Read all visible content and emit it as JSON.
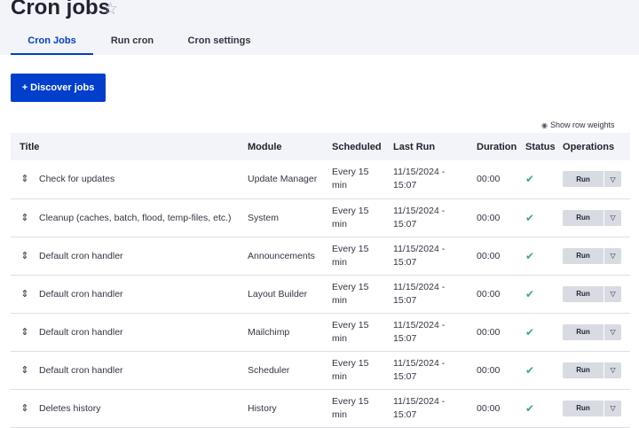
{
  "page": {
    "title": "Cron jobs",
    "star_icon": "star-outline-icon"
  },
  "tabs": [
    {
      "label": "Cron Jobs",
      "active": true
    },
    {
      "label": "Run cron",
      "active": false
    },
    {
      "label": "Cron settings",
      "active": false
    }
  ],
  "toolbar": {
    "discover_label": "+ Discover jobs",
    "row_weights_label": "Show row weights"
  },
  "table": {
    "columns": [
      "Title",
      "Module",
      "Scheduled",
      "Last Run",
      "Duration",
      "Status",
      "Operations"
    ],
    "rows": [
      {
        "title": "Check for updates",
        "module": "Update Manager",
        "scheduled_1": "Every 15",
        "scheduled_2": "min",
        "lastrun_1": "11/15/2024 -",
        "lastrun_2": "15:07",
        "duration": "00:00",
        "status": "✔",
        "op_label": "Run"
      },
      {
        "title": "Cleanup (caches, batch, flood, temp-files, etc.)",
        "module": "System",
        "scheduled_1": "Every 15",
        "scheduled_2": "min",
        "lastrun_1": "11/15/2024 -",
        "lastrun_2": "15:07",
        "duration": "00:00",
        "status": "✔",
        "op_label": "Run"
      },
      {
        "title": "Default cron handler",
        "module": "Announcements",
        "scheduled_1": "Every 15",
        "scheduled_2": "min",
        "lastrun_1": "11/15/2024 -",
        "lastrun_2": "15:07",
        "duration": "00:00",
        "status": "✔",
        "op_label": "Run"
      },
      {
        "title": "Default cron handler",
        "module": "Layout Builder",
        "scheduled_1": "Every 15",
        "scheduled_2": "min",
        "lastrun_1": "11/15/2024 -",
        "lastrun_2": "15:07",
        "duration": "00:00",
        "status": "✔",
        "op_label": "Run"
      },
      {
        "title": "Default cron handler",
        "module": "Mailchimp",
        "scheduled_1": "Every 15",
        "scheduled_2": "min",
        "lastrun_1": "11/15/2024 -",
        "lastrun_2": "15:07",
        "duration": "00:00",
        "status": "✔",
        "op_label": "Run"
      },
      {
        "title": "Default cron handler",
        "module": "Scheduler",
        "scheduled_1": "Every 15",
        "scheduled_2": "min",
        "lastrun_1": "11/15/2024 -",
        "lastrun_2": "15:07",
        "duration": "00:00",
        "status": "✔",
        "op_label": "Run"
      },
      {
        "title": "Deletes history",
        "module": "History",
        "scheduled_1": "Every 15",
        "scheduled_2": "min",
        "lastrun_1": "11/15/2024 -",
        "lastrun_2": "15:07",
        "duration": "00:00",
        "status": "✔",
        "op_label": "Run"
      }
    ]
  },
  "colors": {
    "accent": "#003ecc",
    "header_bg": "#f3f4f9",
    "success": "#42a877",
    "button_bg": "#d9dbe3"
  },
  "icons": {
    "drag": "drag-handle-icon",
    "status": "check-icon",
    "dropdown": "chevron-down-icon",
    "eye": "eye-icon"
  }
}
